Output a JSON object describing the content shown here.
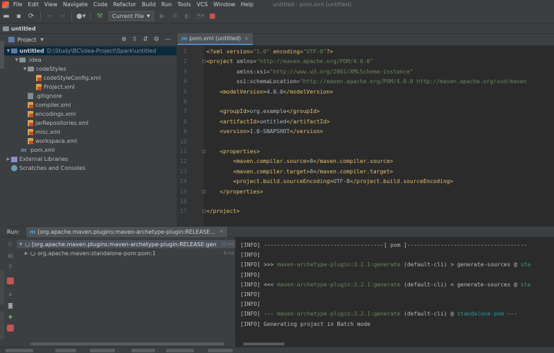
{
  "menu": {
    "items": [
      "File",
      "Edit",
      "View",
      "Navigate",
      "Code",
      "Refactor",
      "Build",
      "Run",
      "Tools",
      "VCS",
      "Window",
      "Help"
    ],
    "window_title": "untitled - pom.xml (untitled)"
  },
  "toolbar": {
    "run_config": "Current File"
  },
  "breadcrumb": {
    "project": "untitled"
  },
  "project_panel": {
    "title": "Project",
    "tree": [
      {
        "label": "untitled",
        "path": "D:\\Study\\BC\\idea-Project\\Spark\\untitled"
      },
      {
        "label": ".idea"
      },
      {
        "label": "codeStyles"
      },
      {
        "label": "codeStyleConfig.xml"
      },
      {
        "label": "Project.xml"
      },
      {
        "label": ".gitignore"
      },
      {
        "label": "compiler.xml"
      },
      {
        "label": "encodings.xml"
      },
      {
        "label": "jarRepositories.xml"
      },
      {
        "label": "misc.xml"
      },
      {
        "label": "workspace.xml"
      },
      {
        "label": "pom.xml"
      },
      {
        "label": "External Libraries"
      },
      {
        "label": "Scratches and Consoles"
      }
    ]
  },
  "editor": {
    "tab_label": "pom.xml (untitled)",
    "line_numbers": [
      "1",
      "2",
      "3",
      "4",
      "5",
      "6",
      "7",
      "8",
      "9",
      "10",
      "11",
      "12",
      "13",
      "14",
      "15",
      "16",
      "17"
    ],
    "lines": [
      [
        {
          "t": "<?xml version=",
          "c": "tag"
        },
        {
          "t": "\"1.0\"",
          "c": "val"
        },
        {
          "t": " encoding=",
          "c": "tag"
        },
        {
          "t": "\"UTF-8\"",
          "c": "val"
        },
        {
          "t": "?>",
          "c": "tag"
        }
      ],
      [
        {
          "t": "<project ",
          "c": "tag"
        },
        {
          "t": "xmlns=",
          "c": "attr"
        },
        {
          "t": "\"http://maven.apache.org/POM/4.0.0\"",
          "c": "val"
        }
      ],
      [
        {
          "t": "         xmlns:xsi=",
          "c": "attr"
        },
        {
          "t": "\"http://www.w3.org/2001/XMLSchema-instance\"",
          "c": "val"
        }
      ],
      [
        {
          "t": "         xsi:schemaLocation=",
          "c": "attr"
        },
        {
          "t": "\"http://maven.apache.org/POM/4.0.0 http://maven.apache.org/xsd/maven",
          "c": "val"
        }
      ],
      [
        {
          "t": "    <modelVersion>",
          "c": "tag"
        },
        {
          "t": "4.0.0",
          "c": "txt"
        },
        {
          "t": "</modelVersion>",
          "c": "tag"
        }
      ],
      [],
      [
        {
          "t": "    <groupId>",
          "c": "tag"
        },
        {
          "t": "org.example",
          "c": "txt"
        },
        {
          "t": "</groupId>",
          "c": "tag"
        }
      ],
      [
        {
          "t": "    <artifactId>",
          "c": "tag"
        },
        {
          "t": "untitled",
          "c": "txt"
        },
        {
          "t": "</artifactId>",
          "c": "tag"
        }
      ],
      [
        {
          "t": "    <version>",
          "c": "tag"
        },
        {
          "t": "1.0-SNAPSHOT",
          "c": "txt"
        },
        {
          "t": "</version>",
          "c": "tag"
        }
      ],
      [],
      [
        {
          "t": "    <properties>",
          "c": "tag"
        }
      ],
      [
        {
          "t": "        <maven.compiler.source>",
          "c": "tag"
        },
        {
          "t": "8",
          "c": "txt"
        },
        {
          "t": "</maven.compiler.source>",
          "c": "tag"
        }
      ],
      [
        {
          "t": "        <maven.compiler.target>",
          "c": "tag"
        },
        {
          "t": "8",
          "c": "txt"
        },
        {
          "t": "</maven.compiler.target>",
          "c": "tag"
        }
      ],
      [
        {
          "t": "        <project.build.sourceEncoding>",
          "c": "tag"
        },
        {
          "t": "UTF-8",
          "c": "txt"
        },
        {
          "t": "</project.build.sourceEncoding>",
          "c": "tag"
        }
      ],
      [
        {
          "t": "    </properties>",
          "c": "tag"
        }
      ],
      [],
      [
        {
          "t": "</project>",
          "c": "tag"
        }
      ]
    ]
  },
  "run_panel": {
    "label": "Run:",
    "tab_label": "[org.apache.maven.plugins:maven-archetype-plugin:RELEASE...",
    "tree": [
      {
        "label": "[org.apache.maven.plugins:maven-archetype-plugin:RELEASE:gen",
        "time": "11 ms"
      },
      {
        "label": "org.apache.maven:standalone-pom:pom:1",
        "time": "6 ms"
      }
    ],
    "console": [
      [
        {
          "t": "[INFO] ",
          "c": ""
        },
        {
          "t": "------------------------------------[ pom ]------------------------------------",
          "c": ""
        }
      ],
      [
        {
          "t": "[INFO]",
          "c": ""
        }
      ],
      [
        {
          "t": "[INFO] >>> ",
          "c": ""
        },
        {
          "t": "maven-archetype-plugin:3.2.1:generate",
          "c": "g"
        },
        {
          "t": " (default-cli) > generate-sources @ ",
          "c": ""
        },
        {
          "t": "sta",
          "c": "c"
        }
      ],
      [
        {
          "t": "[INFO]",
          "c": ""
        }
      ],
      [
        {
          "t": "[INFO] <<< ",
          "c": ""
        },
        {
          "t": "maven-archetype-plugin:3.2.1:generate",
          "c": "g"
        },
        {
          "t": " (default-cli) < generate-sources @ ",
          "c": ""
        },
        {
          "t": "sta",
          "c": "c"
        }
      ],
      [
        {
          "t": "[INFO]",
          "c": ""
        }
      ],
      [
        {
          "t": "[INFO]",
          "c": ""
        }
      ],
      [
        {
          "t": "[INFO] --- ",
          "c": ""
        },
        {
          "t": "maven-archetype-plugin:3.2.1:generate",
          "c": "g"
        },
        {
          "t": " (default-cli) @ ",
          "c": ""
        },
        {
          "t": "standalone-pom",
          "c": "c"
        },
        {
          "t": " ---",
          "c": ""
        }
      ],
      [
        {
          "t": "[INFO] Generating project in Batch mode",
          "c": ""
        }
      ]
    ]
  }
}
